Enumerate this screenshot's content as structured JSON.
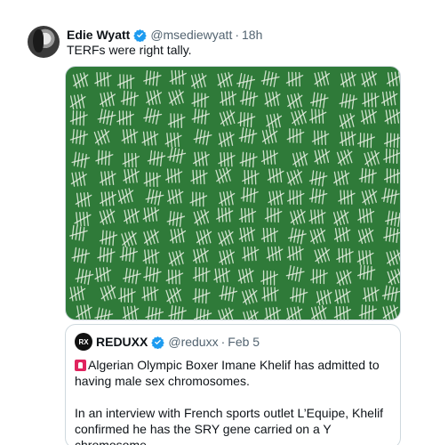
{
  "tweet": {
    "author_name": "Edie Wyatt",
    "handle": "@msediewyatt",
    "separator": "·",
    "time": "18h",
    "text": "TERFs were right tally."
  },
  "media": {
    "description_icon": "chalkboard-tally-image"
  },
  "quote": {
    "author_name": "REDUXX",
    "handle": "@reduxx",
    "separator": "·",
    "date": "Feb 5",
    "avatar_text": "RX",
    "line1": "Algerian Olympic Boxer Imane Khelif has admitted to having male sex chromosomes.",
    "line2": "In an interview with French sports outlet L’Equipe, Khelif confirmed he has the SRY gene carried on a Y chromosome...."
  },
  "colors": {
    "verified": "#1d9bf0",
    "board": "#2f7a39",
    "chalk": "#e9f1e4",
    "muted": "#536471"
  }
}
